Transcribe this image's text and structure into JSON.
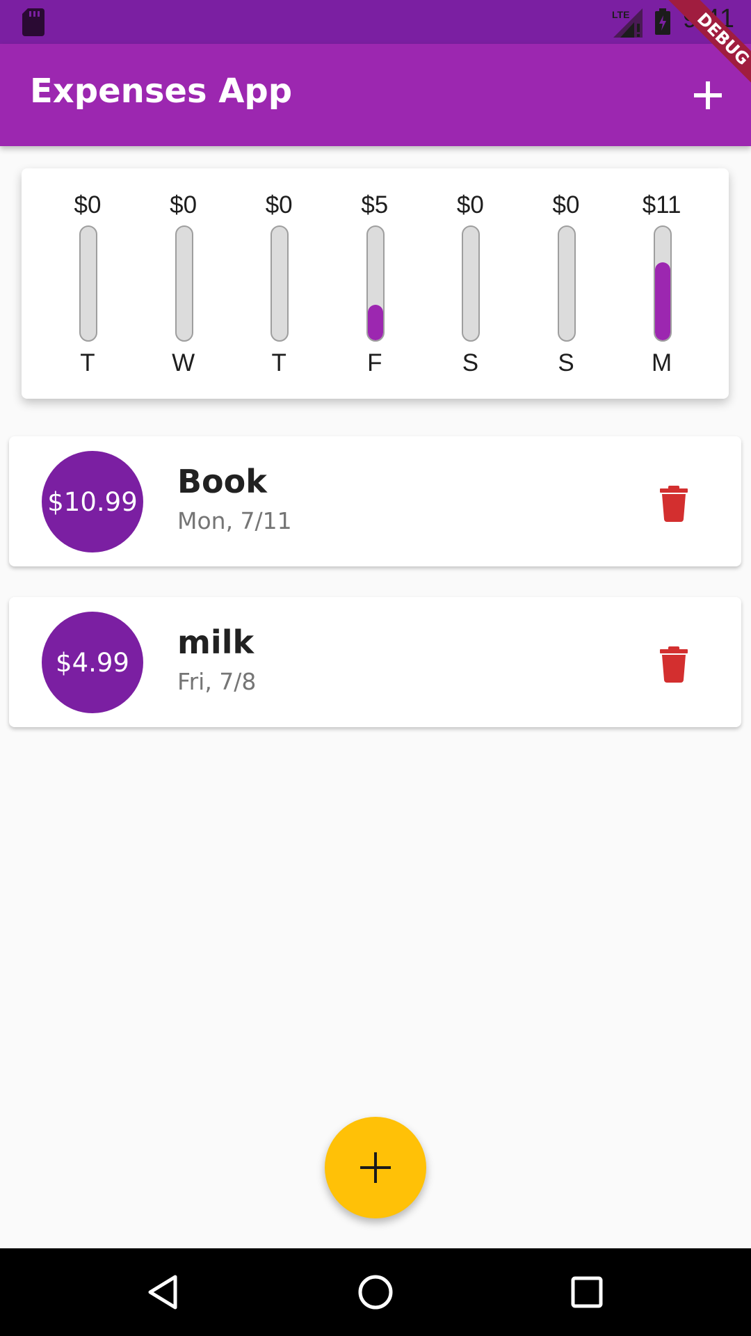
{
  "status_bar": {
    "time": "9:41",
    "network": "LTE",
    "icons": [
      "sd-card-icon",
      "lte-signal-icon",
      "battery-charging-icon"
    ]
  },
  "debug_banner": {
    "label": "DEBUG"
  },
  "app_bar": {
    "title": "Expenses App",
    "action_icon": "add-icon"
  },
  "chart_data": {
    "type": "bar",
    "categories": [
      "T",
      "W",
      "T",
      "F",
      "S",
      "S",
      "M"
    ],
    "amount_labels": [
      "$0",
      "$0",
      "$0",
      "$5",
      "$0",
      "$0",
      "$11"
    ],
    "values": [
      0,
      0,
      0,
      4.99,
      0,
      0,
      10.99
    ],
    "ylim": [
      0,
      15.98
    ],
    "bar_color": "#9c27b0",
    "track_color": "#dcdcdc"
  },
  "transactions": [
    {
      "amount": "$10.99",
      "title": "Book",
      "date": "Mon, 7/11",
      "delete_icon": "trash-icon"
    },
    {
      "amount": "$4.99",
      "title": "milk",
      "date": "Fri, 7/8",
      "delete_icon": "trash-icon"
    }
  ],
  "fab": {
    "icon": "add-icon",
    "color": "#ffc107"
  },
  "nav_bar": {
    "icons": [
      "back-icon",
      "home-icon",
      "recents-icon"
    ]
  },
  "colors": {
    "primary": "#9c27b0",
    "primary_dark": "#7b1fa2",
    "accent": "#ffc107",
    "delete": "#d32f2f"
  }
}
